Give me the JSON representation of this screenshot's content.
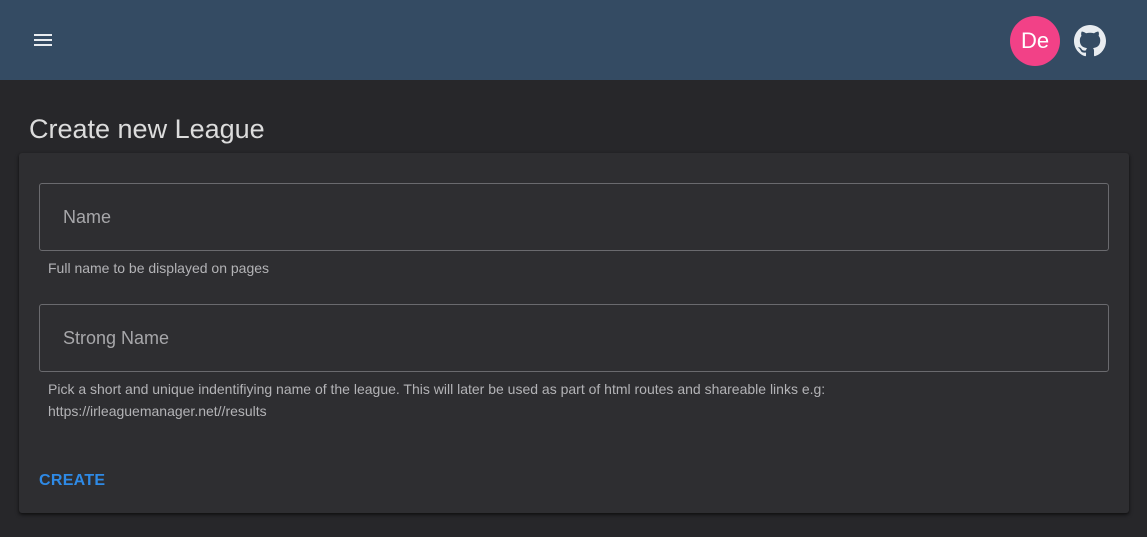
{
  "header": {
    "menu_icon": "hamburger-menu-icon",
    "avatar_initials": "De",
    "avatar_color": "#f24187",
    "github_icon": "github-icon",
    "bar_color": "#344b63"
  },
  "page": {
    "title": "Create new League"
  },
  "form": {
    "name_field": {
      "placeholder": "Name",
      "value": "",
      "hint": "Full name to be displayed on pages"
    },
    "strong_name_field": {
      "placeholder": "Strong Name",
      "value": "",
      "hint": "Pick a short and unique indentifiying name of the league. This will later be used as part of html routes and shareable links e.g: https://irleaguemanager.net//results"
    },
    "create_label": "CREATE",
    "accent_color": "#2e8ae6"
  }
}
